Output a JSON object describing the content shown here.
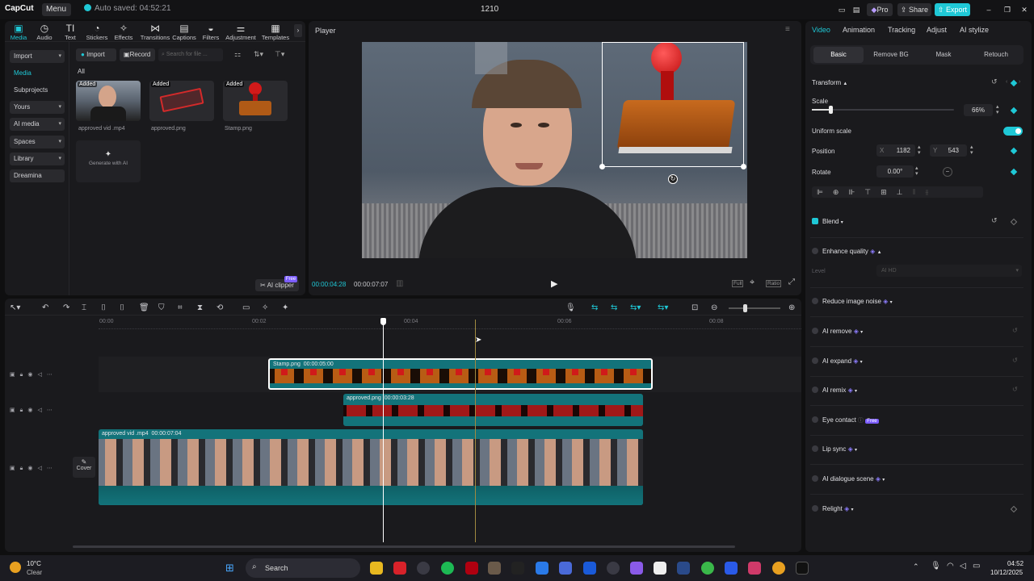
{
  "titlebar": {
    "logo": "CapCut",
    "menu": "Menu",
    "autosave": "Auto saved: 04:52:21",
    "project_title": "1210",
    "pro": "Pro",
    "share": "Share",
    "export": "Export"
  },
  "media": {
    "tabs": [
      {
        "label": "Media",
        "icon": "▣"
      },
      {
        "label": "Audio",
        "icon": "◷"
      },
      {
        "label": "Text",
        "icon": "TI"
      },
      {
        "label": "Stickers",
        "icon": "◔"
      },
      {
        "label": "Effects",
        "icon": "✧"
      },
      {
        "label": "Transitions",
        "icon": "⋈"
      },
      {
        "label": "Captions",
        "icon": "▤"
      },
      {
        "label": "Filters",
        "icon": "◒"
      },
      {
        "label": "Adjustment",
        "icon": "⚌"
      },
      {
        "label": "Templates",
        "icon": "▦"
      }
    ],
    "sidebar": {
      "import": "Import",
      "media": "Media",
      "subprojects": "Subprojects",
      "yours": "Yours",
      "ai_media": "AI media",
      "spaces": "Spaces",
      "library": "Library",
      "dreamina": "Dreamina"
    },
    "import_btn": "Import",
    "record_btn": "Record",
    "search_placeholder": "Search for file ...",
    "filter_all": "All",
    "items": [
      {
        "name": "approved vid .mp4",
        "tag": "Added"
      },
      {
        "name": "approved.png",
        "tag": "Added"
      },
      {
        "name": "Stamp.png",
        "tag": "Added"
      }
    ],
    "generate_ai": "Generate with AI",
    "ai_clipper": "AI clipper",
    "free_badge": "Free"
  },
  "player": {
    "title": "Player",
    "time_current": "00:00:04:28",
    "time_total": "00:00:07:07",
    "btn_full": "Full",
    "btn_ratio": "Ratio"
  },
  "props": {
    "tabs": [
      "Video",
      "Animation",
      "Tracking",
      "Adjust",
      "AI stylize"
    ],
    "subtabs": [
      "Basic",
      "Remove BG",
      "Mask",
      "Retouch"
    ],
    "transform": "Transform",
    "scale_label": "Scale",
    "scale_value": "66%",
    "scale_fraction": 0.66,
    "uniform_scale": "Uniform scale",
    "position_label": "Position",
    "pos_x_label": "X",
    "pos_x": "1182",
    "pos_y_label": "Y",
    "pos_y": "543",
    "rotate_label": "Rotate",
    "rotate_value": "0.00°",
    "blend": "Blend",
    "enhance_quality": "Enhance quality",
    "level_label": "Level",
    "level_value": "AI HD",
    "reduce_noise": "Reduce image noise",
    "ai_remove": "AI remove",
    "ai_expand": "AI expand",
    "ai_remix": "AI remix",
    "eye_contact": "Eye contact",
    "eye_badge": "Free",
    "lip_sync": "Lip sync",
    "ai_dialogue": "AI dialogue scene",
    "relight": "Relight"
  },
  "timeline": {
    "ruler": [
      "00:00",
      "00:02",
      "00:04",
      "00:06",
      "00:08"
    ],
    "tracks": [
      {
        "label": "Stamp.png",
        "duration": "00:00:05:00"
      },
      {
        "label": "approved.png",
        "duration": "00:00:03:28"
      },
      {
        "label": "approved vid .mp4",
        "duration": "00:00:07:04"
      }
    ],
    "cover": "Cover"
  },
  "taskbar": {
    "temp": "10°C",
    "weather": "Clear",
    "search": "Search",
    "time": "04:52",
    "date": "10/12/2025"
  },
  "colors": {
    "accent": "#1fc8d6",
    "panel": "#1a1a1d",
    "track_teal": "#13737a",
    "ai_purple": "#8c7cff"
  }
}
